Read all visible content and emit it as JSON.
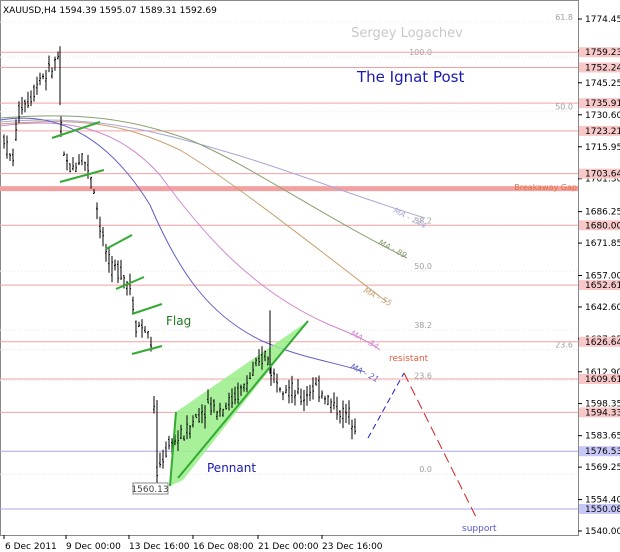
{
  "chart_data": {
    "type": "candlestick",
    "symbol": "XAUUSD,H4",
    "ohlc_header": "XAUUSD,H4  1594.39 1595.07 1589.31 1592.69",
    "watermark": "Sergey Logachev",
    "title": "The Ignat Post",
    "y_ticks": [
      "1774.45",
      "1759.90",
      "1745.25",
      "1730.60",
      "1715.95",
      "1701.30",
      "1686.25",
      "1671.85",
      "1657.00",
      "1642.60",
      "1627.95",
      "1612.90",
      "1598.35",
      "1583.65",
      "1569.25",
      "1554.40",
      "1540.00"
    ],
    "x_ticks": [
      "6 Dec 2011",
      "9 Dec 00:00",
      "13 Dec 16:00",
      "16 Dec 08:00",
      "21 Dec 00:00",
      "23 Dec 16:00"
    ],
    "price_tags": [
      {
        "value": "1759.23",
        "price": 1759.23
      },
      {
        "value": "1752.24",
        "price": 1752.24
      },
      {
        "value": "1735.91",
        "price": 1735.91
      },
      {
        "value": "1723.21",
        "price": 1723.21
      },
      {
        "value": "1703.64",
        "price": 1703.64
      },
      {
        "value": "1680.00",
        "price": 1680.0
      },
      {
        "value": "1652.61",
        "price": 1652.61
      },
      {
        "value": "1626.64",
        "price": 1626.64
      },
      {
        "value": "1609.61",
        "price": 1609.61
      },
      {
        "value": "1594.33",
        "price": 1594.33
      },
      {
        "value": "1576.53",
        "price": 1576.53
      },
      {
        "value": "1550.08",
        "price": 1550.08
      }
    ],
    "fibo_levels": [
      {
        "label": "61.8",
        "price": 1773
      },
      {
        "label": "100.0",
        "price": 1757
      },
      {
        "label": "50.0",
        "price": 1732
      },
      {
        "label": "38.2",
        "price": 1680
      },
      {
        "label": "50.0",
        "price": 1659
      },
      {
        "label": "38.2",
        "price": 1632
      },
      {
        "label": "23.6",
        "price": 1623
      },
      {
        "label": "23.6",
        "price": 1609
      },
      {
        "label": "0.0",
        "price": 1566
      }
    ],
    "moving_averages": [
      {
        "name": "MA - 144",
        "color": "#a8a8d8"
      },
      {
        "name": "MA - 89",
        "color": "#88a070"
      },
      {
        "name": "MA - 55",
        "color": "#c8a070"
      },
      {
        "name": "MA - 34",
        "color": "#d088d0"
      },
      {
        "name": "MA - 21",
        "color": "#6060c8"
      }
    ],
    "annotations": {
      "breakaway_gap": "Breakaway Gap",
      "flag": "Flag",
      "pennant": "Pennant",
      "resistant": "resistant",
      "support": "support",
      "low_label": "1560.13"
    },
    "colors": {
      "candle": "#000000",
      "channel": "#33aa33",
      "pennant_fill": "#99ee88",
      "level_line": "#f4a0a0",
      "support_line": "#a8a8e8",
      "breakaway": "#f5a0a0",
      "forecast_up": "#2020c0",
      "forecast_down": "#d02020",
      "title_color": "#1a1ab0",
      "flag_color": "#227722",
      "resistant_color": "#e06040",
      "support_color": "#5555cc"
    }
  }
}
